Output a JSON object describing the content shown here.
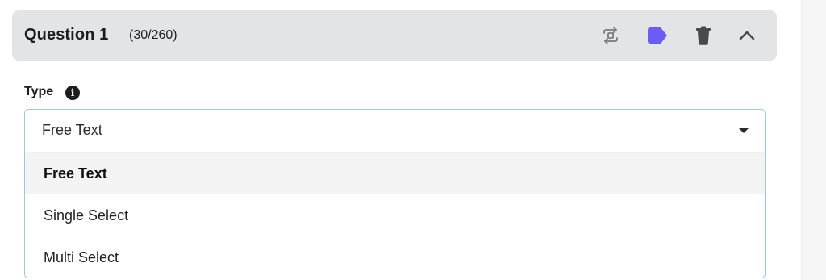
{
  "question": {
    "title": "Question 1",
    "char_count": "(30/260)",
    "actions": [
      {
        "icon": "swap-icon",
        "label": "Swap"
      },
      {
        "icon": "tag-icon",
        "label": "Tag",
        "color": "#6b5cf6"
      },
      {
        "icon": "trash-icon",
        "label": "Delete"
      },
      {
        "icon": "chevron-up-icon",
        "label": "Collapse"
      }
    ]
  },
  "type_field": {
    "label": "Type",
    "info_icon": "info-icon",
    "selected_value": "Free Text",
    "options": [
      {
        "label": "Free Text",
        "selected": true
      },
      {
        "label": "Single Select",
        "selected": false
      },
      {
        "label": "Multi Select",
        "selected": false
      }
    ]
  },
  "colors": {
    "header_bg": "#e3e4e6",
    "accent": "#6b5cf6",
    "select_border": "#9fc7dc",
    "icon_gray": "#4a4a4a"
  }
}
